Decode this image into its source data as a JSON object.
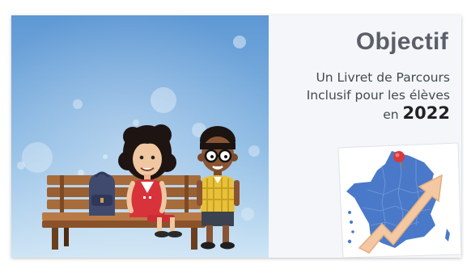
{
  "slide": {
    "title": "Objectif",
    "subtitle_line1": "Un Livret de Parcours",
    "subtitle_line2": "Inclusif pour les élèves",
    "subtitle_line3_prefix": "en",
    "year": "2022"
  },
  "colors": {
    "scene_bg_top": "#6fa3d8",
    "scene_bg_bottom": "#c9e1f3",
    "panel_bg": "#f4f6f9",
    "title": "#5a5f68",
    "map_blue": "#4a79c9",
    "arrow": "#f3c8a2",
    "pin": "#d8393d"
  }
}
